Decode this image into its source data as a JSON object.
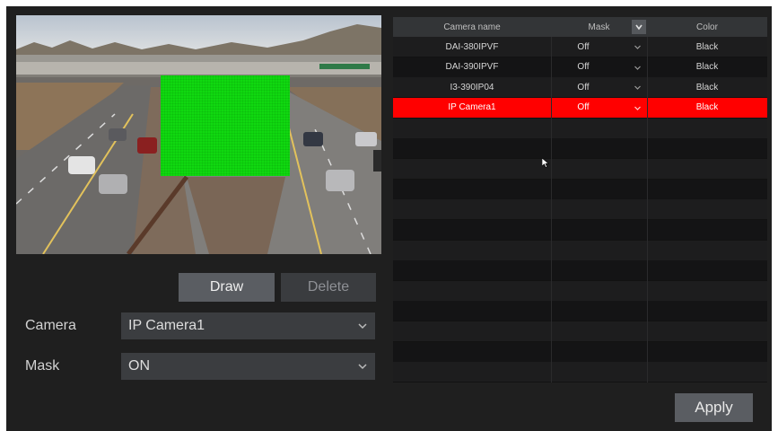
{
  "preview": {
    "colors": {
      "mask": "#10d810",
      "sky": "#c8ccd2",
      "road": "#6f6c69"
    }
  },
  "buttons": {
    "draw_label": "Draw",
    "delete_label": "Delete",
    "apply_label": "Apply"
  },
  "form": {
    "camera_label": "Camera",
    "camera_value": "IP Camera1",
    "mask_label": "Mask",
    "mask_value": "ON"
  },
  "table": {
    "headers": {
      "name": "Camera name",
      "mask": "Mask",
      "color": "Color"
    },
    "rows": [
      {
        "name": "DAI-380IPVF",
        "mask": "Off",
        "color": "Black",
        "selected": false
      },
      {
        "name": "DAI-390IPVF",
        "mask": "Off",
        "color": "Black",
        "selected": false
      },
      {
        "name": "I3-390IP04",
        "mask": "Off",
        "color": "Black",
        "selected": false
      },
      {
        "name": "IP Camera1",
        "mask": "Off",
        "color": "Black",
        "selected": true
      }
    ],
    "selected_color": "#ff0000"
  },
  "icons": {
    "dropdown": "chevron-down-icon",
    "cursor": "mouse-pointer-icon"
  }
}
